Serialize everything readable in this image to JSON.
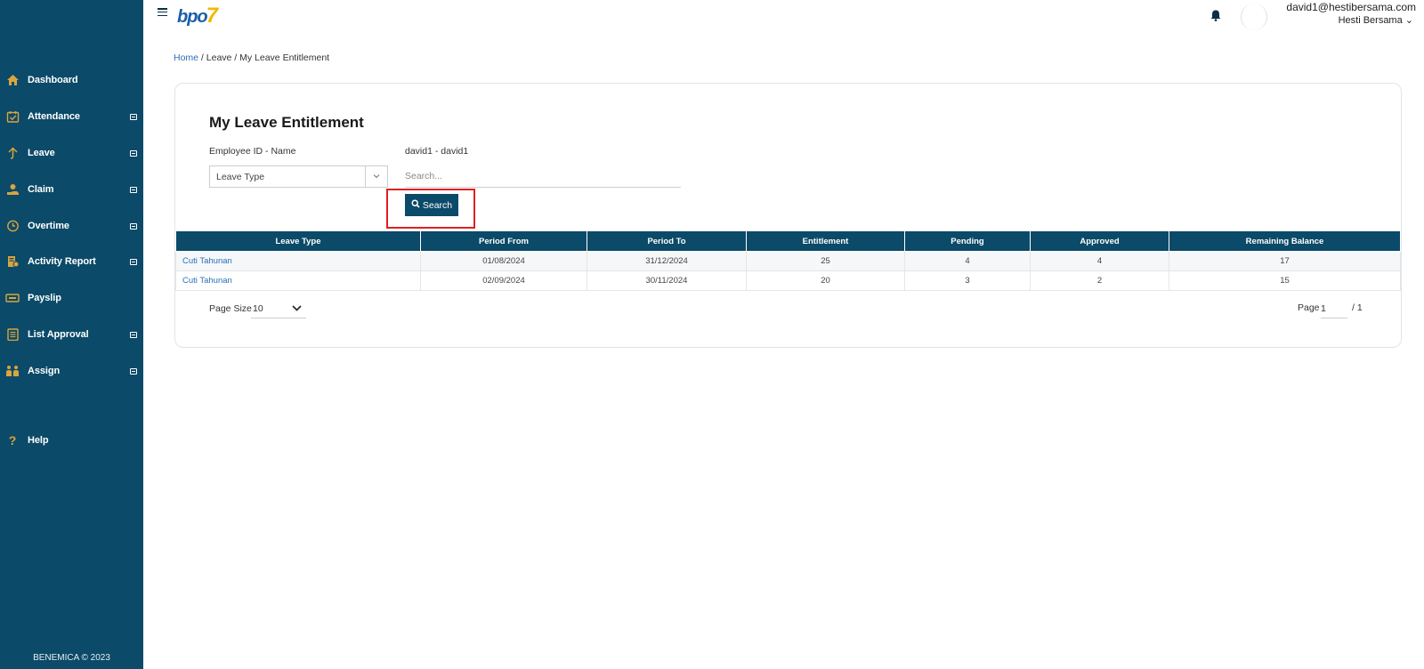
{
  "app": {
    "logo_text": "bpo",
    "logo_seven": "7"
  },
  "user": {
    "email": "david1@hestibersama.com",
    "company": "Hesti Bersama"
  },
  "sidebar": {
    "items": [
      {
        "label": "Dashboard",
        "icon": "home-icon",
        "expandable": false
      },
      {
        "label": "Attendance",
        "icon": "calendar-check-icon",
        "expandable": true
      },
      {
        "label": "Leave",
        "icon": "arrow-up-icon",
        "expandable": true
      },
      {
        "label": "Claim",
        "icon": "hand-coin-icon",
        "expandable": true
      },
      {
        "label": "Overtime",
        "icon": "clock-icon",
        "expandable": true
      },
      {
        "label": "Activity Report",
        "icon": "report-icon",
        "expandable": true
      },
      {
        "label": "Payslip",
        "icon": "payslip-icon",
        "expandable": false
      },
      {
        "label": "List Approval",
        "icon": "list-icon",
        "expandable": true
      },
      {
        "label": "Assign",
        "icon": "people-icon",
        "expandable": true
      },
      {
        "label": "Help",
        "icon": "question-icon",
        "expandable": false
      }
    ],
    "footer": "BENEMICA © 2023"
  },
  "breadcrumb": {
    "home": "Home",
    "rest": " / Leave / My Leave Entitlement"
  },
  "main": {
    "title": "My Leave Entitlement",
    "employee_label": "Employee ID - Name",
    "employee_value": "david1 - david1",
    "leave_type_select": "Leave Type",
    "search_placeholder": "Search...",
    "search_button": "Search"
  },
  "table": {
    "headers": [
      "Leave Type",
      "Period From",
      "Period To",
      "Entitlement",
      "Pending",
      "Approved",
      "Remaining Balance"
    ],
    "rows": [
      [
        "Cuti Tahunan",
        "01/08/2024",
        "31/12/2024",
        "25",
        "4",
        "4",
        "17"
      ],
      [
        "Cuti Tahunan",
        "02/09/2024",
        "30/11/2024",
        "20",
        "3",
        "2",
        "15"
      ]
    ]
  },
  "pagination": {
    "page_size_label": "Page Size",
    "page_size": "10",
    "page_label": "Page",
    "page": "1",
    "total": "/ 1"
  },
  "colors": {
    "sidebar": "#0b4a68",
    "icon_accent": "#d9a441",
    "link": "#2a6fb8",
    "highlight": "#e02020"
  }
}
